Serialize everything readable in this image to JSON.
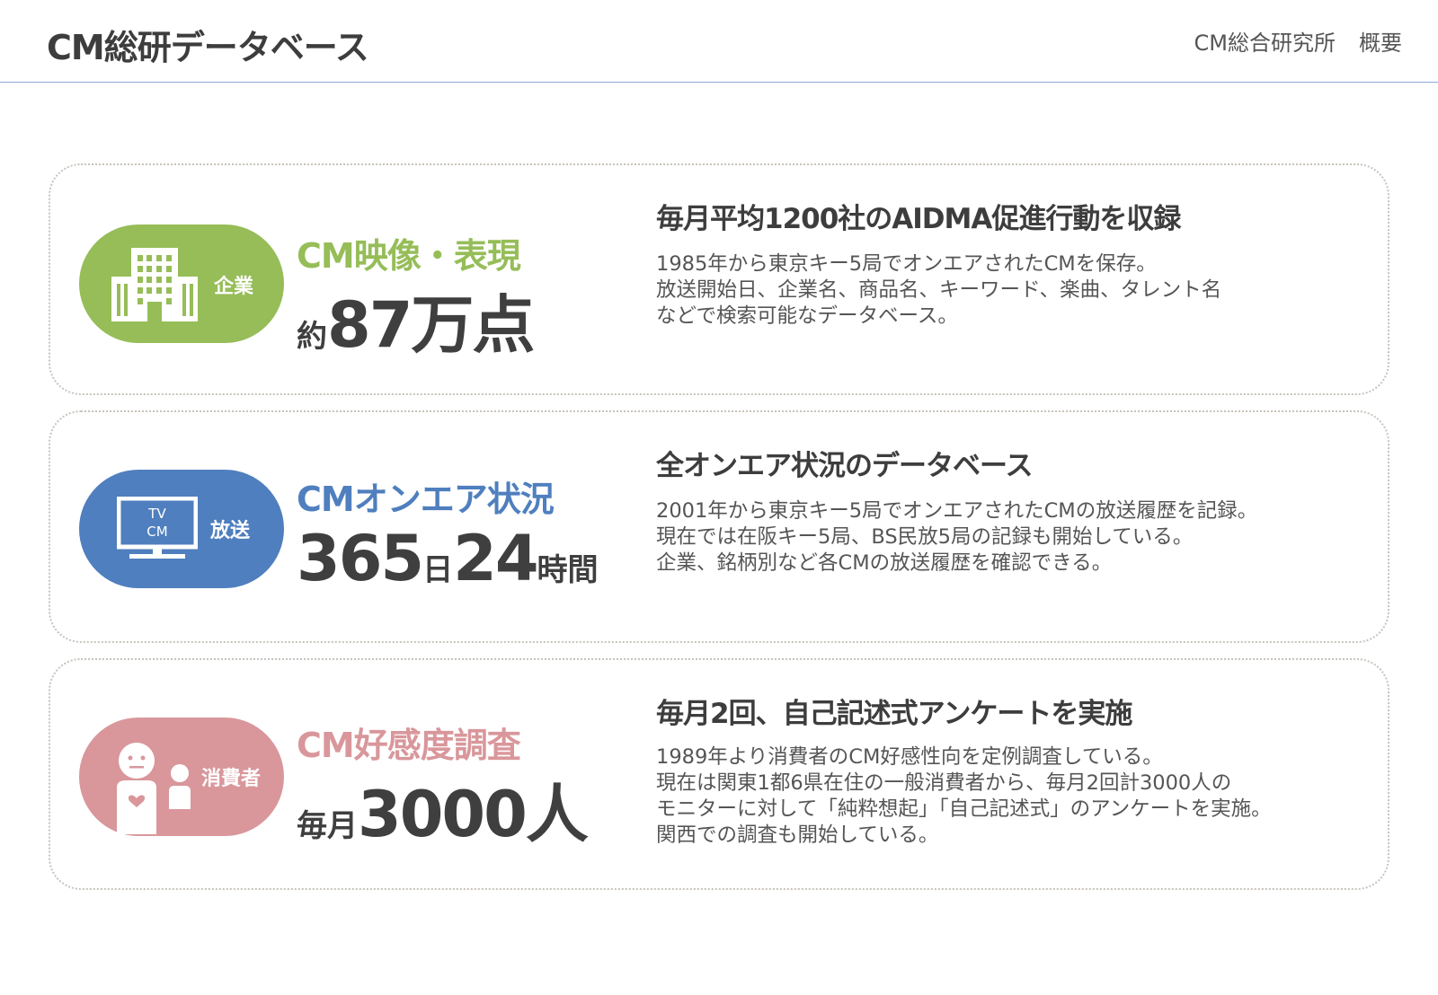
{
  "header": {
    "title": "CM総研データベース",
    "nav": [
      "CM総合研究所",
      "概要"
    ]
  },
  "colors": {
    "green": "#96bd58",
    "blue": "#4f7fbe",
    "pink": "#d9979b",
    "border": "#c8c3bc"
  },
  "cards": [
    {
      "pill_label": "企業",
      "icon": "building-icon",
      "category": "CM映像・表現",
      "stat": {
        "prefix": "約",
        "number": "87万点",
        "mid": "",
        "number2": "",
        "suffix": ""
      },
      "title": "毎月平均1200社のAIDMA促進行動を収録",
      "lines": [
        "1985年から東京キー5局でオンエアされたCMを保存。",
        "放送開始日、企業名、商品名、キーワード、楽曲、タレント名",
        "などで検索可能なデータベース。"
      ]
    },
    {
      "pill_label": "放送",
      "icon": "tv-icon",
      "tv_text": [
        "TV",
        "CM"
      ],
      "category": "CMオンエア状況",
      "stat": {
        "prefix": "",
        "number": "365",
        "mid": "日",
        "number2": "24",
        "suffix": "時間"
      },
      "title": "全オンエア状況のデータベース",
      "lines": [
        "2001年から東京キー5局でオンエアされたCMの放送履歴を記録。",
        "現在では在阪キー5局、BS民放5局の記録も開始している。",
        "企業、銘柄別など各CMの放送履歴を確認できる。"
      ]
    },
    {
      "pill_label": "消費者",
      "icon": "consumer-icon",
      "category": "CM好感度調査",
      "stat": {
        "prefix": "毎月",
        "number": "3000人",
        "mid": "",
        "number2": "",
        "suffix": ""
      },
      "title": "毎月2回、自己記述式アンケートを実施",
      "lines": [
        "1989年より消費者のCM好感性向を定例調査している。",
        "現在は関東1都6県在住の一般消費者から、毎月2回計3000人の",
        "モニターに対して「純粋想起」「自己記述式」のアンケートを実施。",
        "関西での調査も開始している。"
      ]
    }
  ]
}
